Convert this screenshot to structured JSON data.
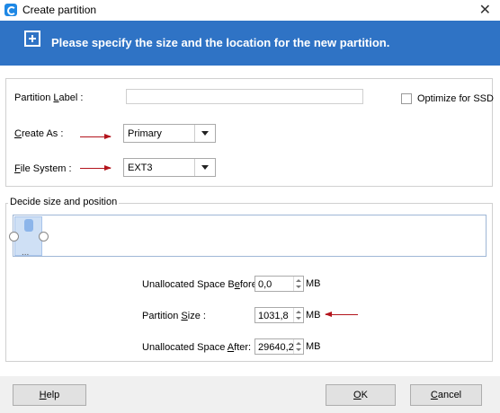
{
  "window": {
    "title": "Create partition"
  },
  "banner": {
    "text": "Please specify the size and the location for the new partition."
  },
  "form": {
    "partition_label": {
      "label_prefix": "Partition ",
      "label_key": "L",
      "label_suffix": "abel :",
      "value": ""
    },
    "optimize_ssd": {
      "label": "Optimize for SSD",
      "checked": false
    },
    "create_as": {
      "label_key": "C",
      "label_suffix": "reate As :",
      "value": "Primary"
    },
    "file_system": {
      "label_key": "F",
      "label_suffix": "ile System :",
      "value": "EXT3"
    }
  },
  "layout_group": {
    "title": "Decide size and position",
    "bar_dots": "...",
    "unallocated_before": {
      "label_prefix": "Unallocated Space B",
      "label_key": "e",
      "label_suffix": "fore:",
      "value": "0,0",
      "unit": "MB"
    },
    "partition_size": {
      "label_prefix": "Partition ",
      "label_key": "S",
      "label_suffix": "ize :",
      "value": "1031,8",
      "unit": "MB"
    },
    "unallocated_after": {
      "label_prefix": "Unallocated Space ",
      "label_key": "A",
      "label_suffix": "fter:",
      "value": "29640,2",
      "unit": "MB"
    }
  },
  "buttons": {
    "help": {
      "key": "H",
      "rest": "elp"
    },
    "ok": {
      "key": "O",
      "rest": "K"
    },
    "cancel": {
      "key": "C",
      "rest": "ancel"
    }
  },
  "colors": {
    "banner": "#2f73c5",
    "arrow": "#b3141c",
    "footer": "#f0f0f0"
  }
}
